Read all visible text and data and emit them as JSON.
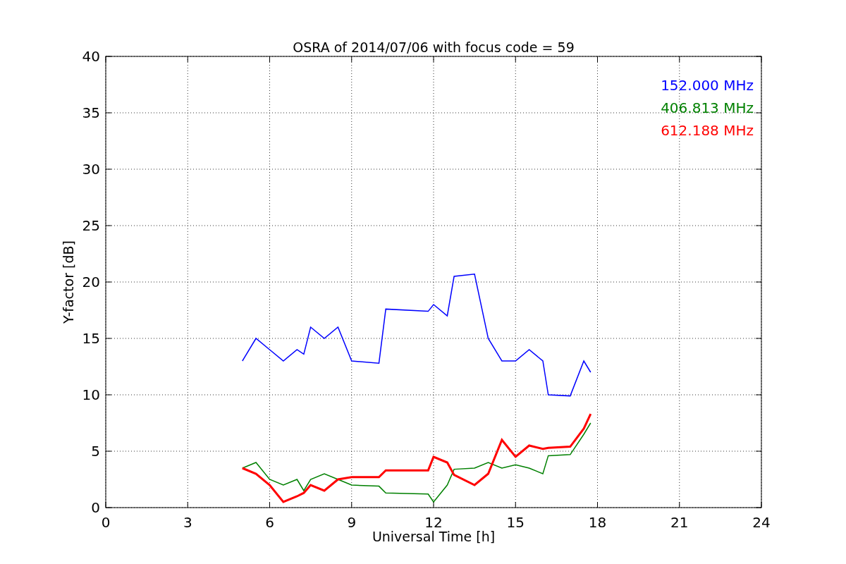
{
  "figure": {
    "chart_data": {
      "type": "line",
      "title": "OSRA of 2014/07/06 with focus code = 59",
      "xlabel": "Universal Time [h]",
      "ylabel": "Y-factor [dB]",
      "x": [
        5,
        5.5,
        6,
        6.5,
        7,
        7.25,
        7.5,
        8,
        8.5,
        9,
        10,
        10.25,
        11.8,
        12,
        12.5,
        12.75,
        13.5,
        14,
        14.5,
        15,
        15.5,
        16,
        16.2,
        17,
        17.5,
        17.75
      ],
      "series": [
        {
          "name": "152.000 MHz",
          "color": "#0000ff",
          "values": [
            13,
            15,
            14,
            13,
            14,
            13.6,
            16,
            15,
            16,
            13,
            12.8,
            17.6,
            17.4,
            18,
            17,
            20.5,
            20.7,
            15,
            13,
            13,
            14,
            13,
            10,
            9.9,
            13,
            12
          ]
        },
        {
          "name": "406.813 MHz",
          "color": "#008000",
          "values": [
            3.5,
            4,
            2.5,
            2,
            2.5,
            1.5,
            2.5,
            3,
            2.5,
            2,
            1.9,
            1.3,
            1.2,
            0.5,
            2,
            3.4,
            3.5,
            4,
            3.5,
            3.8,
            3.5,
            3,
            4.6,
            4.7,
            6.5,
            7.5
          ]
        },
        {
          "name": "612.188 MHz",
          "color": "#ff0000",
          "values": [
            3.5,
            3,
            2,
            0.5,
            1,
            1.3,
            2,
            1.5,
            2.5,
            2.7,
            2.7,
            3.3,
            3.3,
            4.5,
            4,
            2.9,
            2,
            3,
            6,
            4.5,
            5.5,
            5.2,
            5.3,
            5.4,
            7,
            8.3
          ]
        }
      ],
      "grid": true,
      "xlim": [
        0,
        24
      ],
      "ylim": [
        0,
        40
      ],
      "xticks": [
        0,
        3,
        6,
        9,
        12,
        15,
        18,
        21,
        24
      ],
      "yticks": [
        0,
        5,
        10,
        15,
        20,
        25,
        30,
        35,
        40
      ]
    }
  }
}
